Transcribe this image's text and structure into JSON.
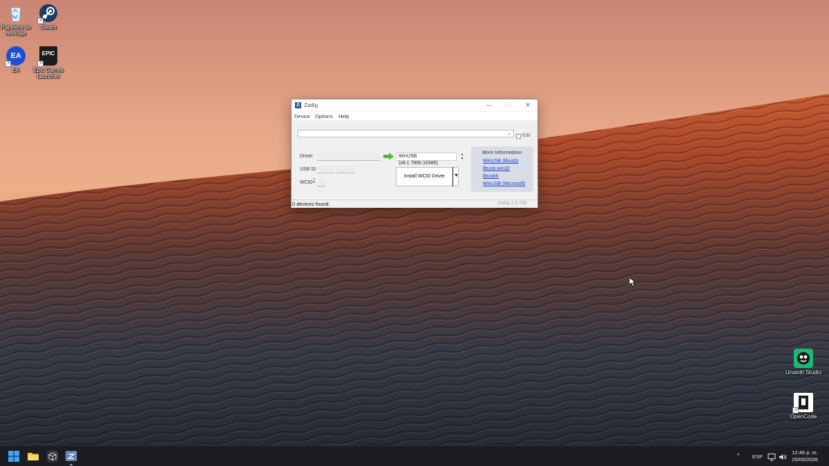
{
  "desktop": {
    "icons_left": [
      {
        "name": "recycle-bin",
        "label": "Papelera de reciclaje"
      },
      {
        "name": "steam",
        "label": "Steam"
      },
      {
        "name": "ea",
        "label": "EA",
        "glyph": "EA"
      },
      {
        "name": "epic",
        "label": "Epic Games Launcher",
        "glyph": "EPIC"
      }
    ],
    "icons_right": [
      {
        "name": "unsloth",
        "label": "Unsloth Studio"
      },
      {
        "name": "opencode",
        "label": "OpenCode"
      }
    ]
  },
  "window": {
    "title": "Zadig",
    "app_icon_glyph": "Z",
    "controls": {
      "minimize": "—",
      "maximize": "☐",
      "close": "✕"
    },
    "menu": [
      "Device",
      "Options",
      "Help"
    ],
    "device_dropdown": {
      "value": ""
    },
    "edit_label": "Edit",
    "labels": {
      "driver": "Driver",
      "usb_id": "USB ID",
      "wcid": "WCID",
      "wcid_sup": "?"
    },
    "target_driver": "WinUSB (v6.1.7600.16385)",
    "install_button": "Install WCID Driver",
    "more_info": {
      "title": "More Information",
      "links": [
        "WinUSB (libusb)",
        "libusb-win32",
        "libusbK",
        "WinUSB (Microsoft)"
      ]
    },
    "status": {
      "left": "0 devices found.",
      "right": "Zadig 2.9.788"
    }
  },
  "taskbar": {
    "tray": {
      "chevron": "^",
      "language": "ESP"
    },
    "clock": {
      "time": "12:46 p. m.",
      "date": "25/05/2026"
    }
  },
  "colors": {
    "accent_link": "#1a3fcc",
    "install_arrow": "#4cbb38",
    "taskbar_bg": "#1b1d22"
  }
}
